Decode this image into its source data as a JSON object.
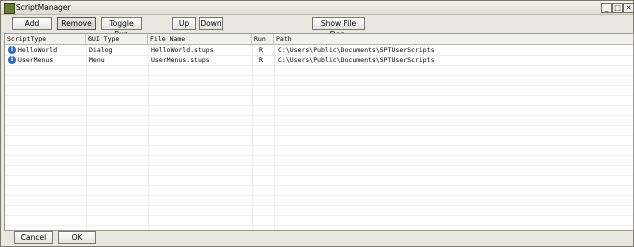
{
  "window": {
    "title": "ScriptManager"
  },
  "titlebar_buttons": {
    "minimize": "_",
    "maximize": "□",
    "close": "✕"
  },
  "toolbar": {
    "add_label": "Add",
    "remove_label": "Remove",
    "toggle_run_label": "Toggle Run",
    "up_label": "Up",
    "down_label": "Down",
    "show_file_dep_label": "Show File Dep."
  },
  "table": {
    "columns": [
      "ScriptType",
      "GUI Type",
      "File Name",
      "Run",
      "Path"
    ],
    "rows": [
      {
        "script_type": "HelloWorld",
        "gui_type": "Dialog",
        "file_name": "HelloWorld.stups",
        "run": "R",
        "path": "C:\\Users\\Public\\Documents\\SPTUserScripts",
        "icon": "info-icon"
      },
      {
        "script_type": "UserMenus",
        "gui_type": "Menu",
        "file_name": "UserMenus.stups",
        "run": "R",
        "path": "C:\\Users\\Public\\Documents\\SPTUserScripts",
        "icon": "info-icon"
      }
    ]
  },
  "footer": {
    "cancel_label": "Cancel",
    "ok_label": "OK"
  }
}
